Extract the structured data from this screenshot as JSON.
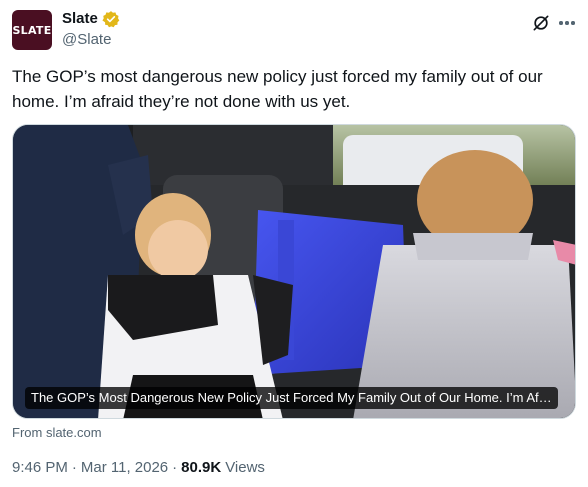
{
  "author": {
    "display_name": "Slate",
    "handle": "@Slate",
    "avatar_text": "SLATE",
    "avatar_color": "#4a0f22",
    "verified_badge": "gold-check-badge",
    "verified_color": "#e2b719"
  },
  "tweet": {
    "text": "The GOP’s most dangerous new policy just forced my family out of our home. I’m afraid they’re not done with us yet."
  },
  "card": {
    "caption": "The GOP’s Most Dangerous New Policy Just Forced My Family Out of Our Home. I’m Af…",
    "source": "From slate.com"
  },
  "meta": {
    "time": "9:46 PM",
    "separator": "·",
    "date": "Mar 11, 2026",
    "views_count": "80.9K",
    "views_label": "Views"
  },
  "icons": {
    "grok": "grok-icon",
    "more": "more-options-icon"
  }
}
